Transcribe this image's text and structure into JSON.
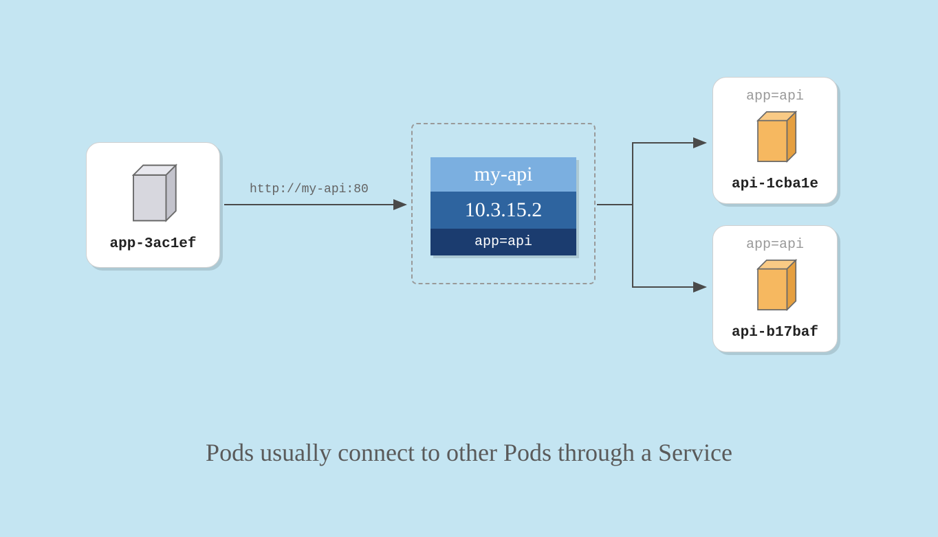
{
  "caption": "Pods usually connect to other Pods through a Service",
  "sourcePod": {
    "name": "app-3ac1ef"
  },
  "requestLabel": "http://my-api:80",
  "service": {
    "name": "my-api",
    "ip": "10.3.15.2",
    "selector": "app=api"
  },
  "targetPods": [
    {
      "selector": "app=api",
      "name": "api-1cba1e"
    },
    {
      "selector": "app=api",
      "name": "api-b17baf"
    }
  ],
  "colors": {
    "background": "#c4e5f2",
    "serviceNameBg": "#7bafe0",
    "serviceIpBg": "#2e649f",
    "serviceSelectorBg": "#1b3c6f",
    "cubeGray": "#d7d7de",
    "cubeOrange": "#f6b860"
  }
}
